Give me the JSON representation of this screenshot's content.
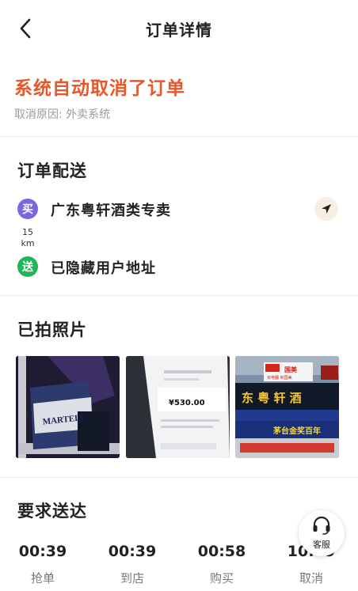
{
  "header": {
    "title": "订单详情"
  },
  "status": {
    "title": "系统自动取消了订单",
    "reason": "取消原因: 外卖系统",
    "accent_color": "#e9562a"
  },
  "delivery": {
    "title": "订单配送",
    "buy_badge": "买",
    "store_name": "广东粤轩酒类专卖",
    "distance_value": "15",
    "distance_unit": "km",
    "send_badge": "送",
    "customer_address": "已隐藏用户地址"
  },
  "photos": {
    "title": "已拍照片",
    "photo1": {
      "box_text": "MARTELL"
    },
    "photo2": {
      "amount": "¥530.00"
    },
    "photo3": {
      "top_sign": "国美",
      "top_sign_sub": "买电器 到国美",
      "main_sign": "东 粤 轩 酒",
      "bottom_sign": "茅台金奖百年"
    }
  },
  "schedule": {
    "title": "要求送达",
    "times": [
      {
        "value": "00:39",
        "label": "抢单"
      },
      {
        "value": "00:39",
        "label": "到店"
      },
      {
        "value": "00:58",
        "label": "购买"
      },
      {
        "value": "10:49",
        "label": "取消"
      }
    ]
  },
  "service": {
    "label": "客服"
  }
}
